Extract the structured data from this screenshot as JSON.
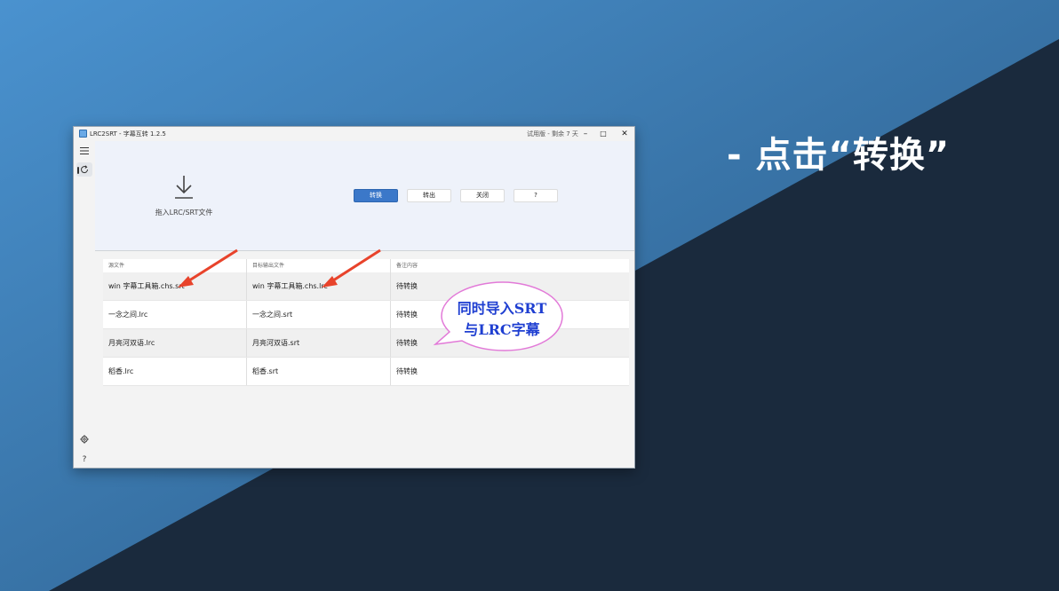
{
  "slide": {
    "caption": "- 点击“转换”",
    "colors": {
      "bg_blue": "#3c7db8",
      "bg_dark": "#1a2a3d",
      "arrow": "#e8432b",
      "bubble_border": "#e27ad8",
      "bubble_text": "#1f3fd1"
    }
  },
  "window": {
    "title": "LRC2SRT - 字幕互转 1.2.5",
    "trial_status": "试用版 - 剩余 7 天",
    "controls": {
      "minimize": "–",
      "maximize": "□",
      "close": "✕"
    }
  },
  "sidebar": {
    "menu_icon": "hamburger-icon",
    "refresh_icon": "refresh-icon",
    "settings_icon": "gear-icon",
    "help_label": "?"
  },
  "drop_zone": {
    "icon": "download-icon",
    "label": "拖入LRC/SRT文件"
  },
  "toolbar": {
    "convert": "转换",
    "export": "转出",
    "close": "关闭",
    "help": "?"
  },
  "table": {
    "headers": [
      "源文件",
      "目标输出文件",
      "备注内容"
    ],
    "rows": [
      [
        "win 字幕工具箱.chs.srt",
        "win 字幕工具箱.chs.lrc",
        "待转换"
      ],
      [
        "一念之间.lrc",
        "一念之间.srt",
        "待转换"
      ],
      [
        "月亮河双语.lrc",
        "月亮河双语.srt",
        "待转换"
      ],
      [
        "稻香.lrc",
        "稻香.srt",
        "待转换"
      ]
    ]
  },
  "annotation": {
    "bubble_line1": "同时导入SRT",
    "bubble_line2": "与LRC字幕"
  }
}
